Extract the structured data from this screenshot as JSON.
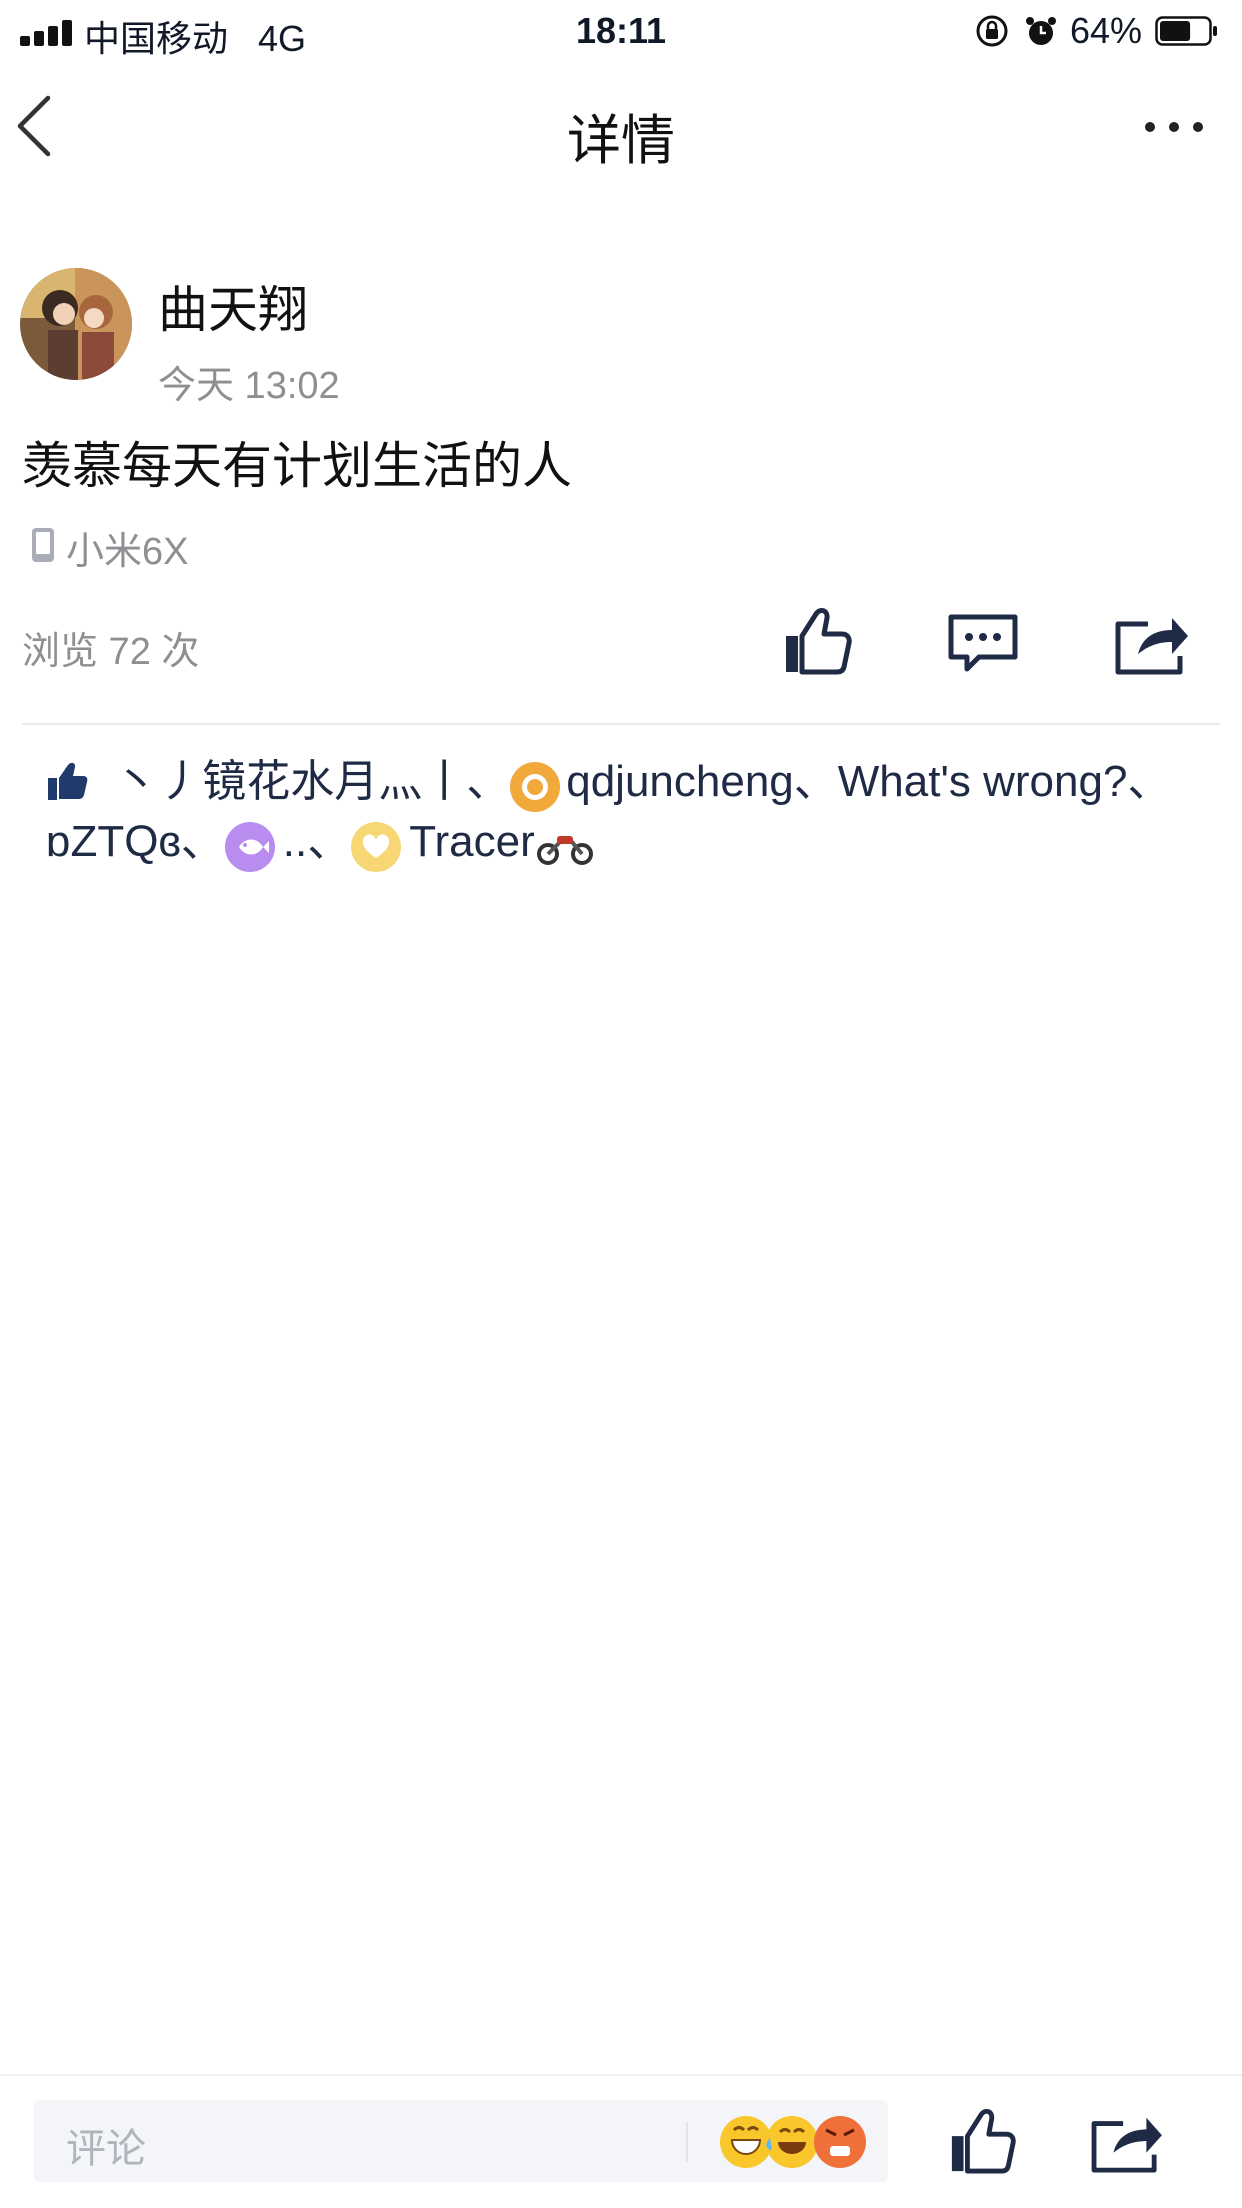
{
  "status_bar": {
    "carrier": "中国移动",
    "network": "4G",
    "time": "18:11",
    "battery": "64%",
    "battery_level": 0.64
  },
  "nav": {
    "title": "详情",
    "back_icon": "chevron-left-icon",
    "more_icon": "more-dots-icon"
  },
  "post": {
    "author": "曲天翔",
    "time": "今天 13:02",
    "text": "羡慕每天有计划生活的人",
    "device": "小米6X",
    "views": "浏览 72 次"
  },
  "actions": {
    "like_icon": "thumbs-up-icon",
    "comment_icon": "chat-bubble-icon",
    "share_icon": "share-icon"
  },
  "likers": {
    "icon": "thumbs-up-filled-icon",
    "line1": [
      "丶丿镜花水月灬丨",
      "、",
      "qdjuncheng",
      "、What's wrong?、"
    ],
    "line2": [
      "ɒZTQɞ",
      "、",
      "..",
      "、",
      "Tracer"
    ],
    "colors": {
      "text": "#1f2a44",
      "badge_orange": "#f2a93b",
      "badge_purple": "#b98cf0",
      "badge_yellow": "#f7d774"
    }
  },
  "bottom_bar": {
    "comment_placeholder": "评论",
    "emoji_icons": [
      "grin-emoji-icon",
      "laugh-cry-emoji-icon",
      "angry-emoji-icon"
    ]
  }
}
